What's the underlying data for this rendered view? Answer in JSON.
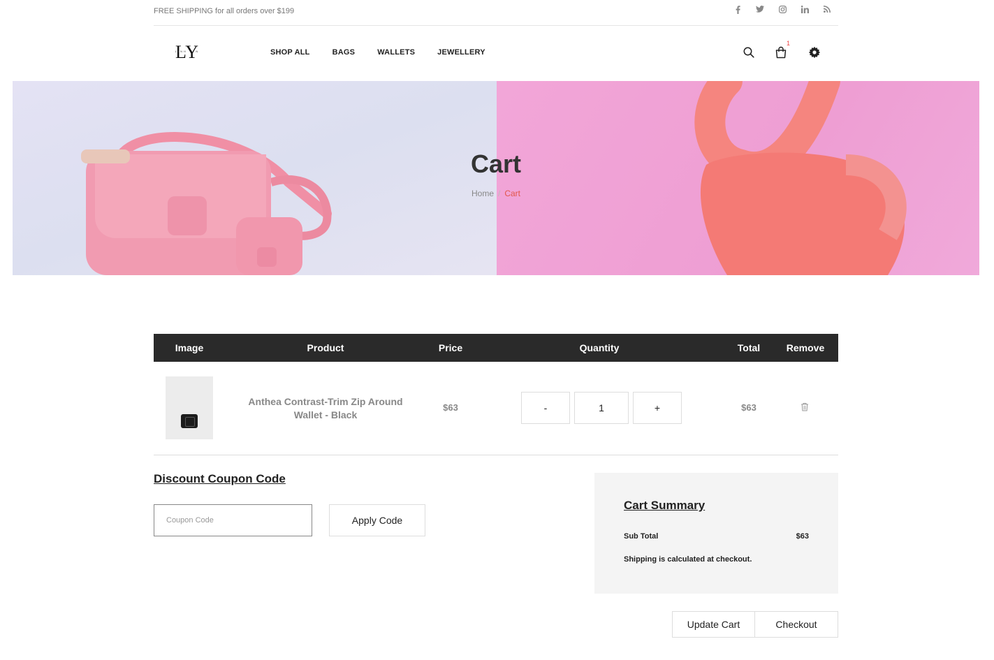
{
  "topbar": {
    "shipping_text": "FREE SHIPPING for all orders over $199",
    "social_icons": [
      "facebook-icon",
      "twitter-icon",
      "instagram-icon",
      "linkedin-icon",
      "rss-icon"
    ]
  },
  "header": {
    "logo": {
      "mark": "LY",
      "subtitle": "LINH YEN"
    },
    "nav": [
      "SHOP ALL",
      "BAGS",
      "WALLETS",
      "JEWELLERY"
    ],
    "cart_count": "1"
  },
  "banner": {
    "title": "Cart",
    "breadcrumb": {
      "home": "Home",
      "separator": "/",
      "current": "Cart"
    }
  },
  "table": {
    "headers": [
      "Image",
      "Product",
      "Price",
      "Quantity",
      "Total",
      "Remove"
    ],
    "rows": [
      {
        "product": "Anthea Contrast-Trim Zip Around Wallet - Black",
        "price": "$63",
        "qty_minus": "-",
        "quantity": "1",
        "qty_plus": "+",
        "total": "$63"
      }
    ]
  },
  "coupon": {
    "title": "Discount Coupon Code",
    "placeholder": "Coupon Code",
    "apply_label": "Apply Code"
  },
  "summary": {
    "title": "Cart Summary",
    "subtotal_label": "Sub Total",
    "subtotal_value": "$63",
    "shipping_note": "Shipping is calculated at checkout."
  },
  "actions": {
    "update_label": "Update Cart",
    "checkout_label": "Checkout"
  },
  "colors": {
    "accent": "#e2574c",
    "table_header": "#2a2a2a"
  }
}
